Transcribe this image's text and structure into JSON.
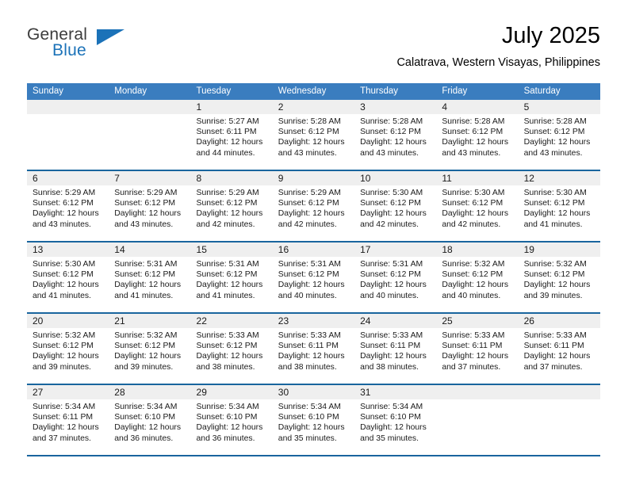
{
  "brand": {
    "name_line1": "General",
    "name_line2": "Blue",
    "flag_icon": "triangle-flag-icon"
  },
  "header": {
    "title": "July 2025",
    "subtitle": "Calatrava, Western Visayas, Philippines"
  },
  "colors": {
    "header_band": "#3a7dbf",
    "row_divider": "#19659e",
    "daynum_band": "#efefef",
    "brand_blue": "#1b72b8",
    "text": "#1a1a1a"
  },
  "weekday_headers": [
    "Sunday",
    "Monday",
    "Tuesday",
    "Wednesday",
    "Thursday",
    "Friday",
    "Saturday"
  ],
  "labels": {
    "sunrise_prefix": "Sunrise:",
    "sunset_prefix": "Sunset:",
    "daylight_prefix": "Daylight:"
  },
  "weeks": [
    [
      {
        "day": "",
        "empty": true
      },
      {
        "day": "",
        "empty": true
      },
      {
        "day": "1",
        "sunrise": "Sunrise: 5:27 AM",
        "sunset": "Sunset: 6:11 PM",
        "daylight1": "Daylight: 12 hours",
        "daylight2": "and 44 minutes."
      },
      {
        "day": "2",
        "sunrise": "Sunrise: 5:28 AM",
        "sunset": "Sunset: 6:12 PM",
        "daylight1": "Daylight: 12 hours",
        "daylight2": "and 43 minutes."
      },
      {
        "day": "3",
        "sunrise": "Sunrise: 5:28 AM",
        "sunset": "Sunset: 6:12 PM",
        "daylight1": "Daylight: 12 hours",
        "daylight2": "and 43 minutes."
      },
      {
        "day": "4",
        "sunrise": "Sunrise: 5:28 AM",
        "sunset": "Sunset: 6:12 PM",
        "daylight1": "Daylight: 12 hours",
        "daylight2": "and 43 minutes."
      },
      {
        "day": "5",
        "sunrise": "Sunrise: 5:28 AM",
        "sunset": "Sunset: 6:12 PM",
        "daylight1": "Daylight: 12 hours",
        "daylight2": "and 43 minutes."
      }
    ],
    [
      {
        "day": "6",
        "sunrise": "Sunrise: 5:29 AM",
        "sunset": "Sunset: 6:12 PM",
        "daylight1": "Daylight: 12 hours",
        "daylight2": "and 43 minutes."
      },
      {
        "day": "7",
        "sunrise": "Sunrise: 5:29 AM",
        "sunset": "Sunset: 6:12 PM",
        "daylight1": "Daylight: 12 hours",
        "daylight2": "and 43 minutes."
      },
      {
        "day": "8",
        "sunrise": "Sunrise: 5:29 AM",
        "sunset": "Sunset: 6:12 PM",
        "daylight1": "Daylight: 12 hours",
        "daylight2": "and 42 minutes."
      },
      {
        "day": "9",
        "sunrise": "Sunrise: 5:29 AM",
        "sunset": "Sunset: 6:12 PM",
        "daylight1": "Daylight: 12 hours",
        "daylight2": "and 42 minutes."
      },
      {
        "day": "10",
        "sunrise": "Sunrise: 5:30 AM",
        "sunset": "Sunset: 6:12 PM",
        "daylight1": "Daylight: 12 hours",
        "daylight2": "and 42 minutes."
      },
      {
        "day": "11",
        "sunrise": "Sunrise: 5:30 AM",
        "sunset": "Sunset: 6:12 PM",
        "daylight1": "Daylight: 12 hours",
        "daylight2": "and 42 minutes."
      },
      {
        "day": "12",
        "sunrise": "Sunrise: 5:30 AM",
        "sunset": "Sunset: 6:12 PM",
        "daylight1": "Daylight: 12 hours",
        "daylight2": "and 41 minutes."
      }
    ],
    [
      {
        "day": "13",
        "sunrise": "Sunrise: 5:30 AM",
        "sunset": "Sunset: 6:12 PM",
        "daylight1": "Daylight: 12 hours",
        "daylight2": "and 41 minutes."
      },
      {
        "day": "14",
        "sunrise": "Sunrise: 5:31 AM",
        "sunset": "Sunset: 6:12 PM",
        "daylight1": "Daylight: 12 hours",
        "daylight2": "and 41 minutes."
      },
      {
        "day": "15",
        "sunrise": "Sunrise: 5:31 AM",
        "sunset": "Sunset: 6:12 PM",
        "daylight1": "Daylight: 12 hours",
        "daylight2": "and 41 minutes."
      },
      {
        "day": "16",
        "sunrise": "Sunrise: 5:31 AM",
        "sunset": "Sunset: 6:12 PM",
        "daylight1": "Daylight: 12 hours",
        "daylight2": "and 40 minutes."
      },
      {
        "day": "17",
        "sunrise": "Sunrise: 5:31 AM",
        "sunset": "Sunset: 6:12 PM",
        "daylight1": "Daylight: 12 hours",
        "daylight2": "and 40 minutes."
      },
      {
        "day": "18",
        "sunrise": "Sunrise: 5:32 AM",
        "sunset": "Sunset: 6:12 PM",
        "daylight1": "Daylight: 12 hours",
        "daylight2": "and 40 minutes."
      },
      {
        "day": "19",
        "sunrise": "Sunrise: 5:32 AM",
        "sunset": "Sunset: 6:12 PM",
        "daylight1": "Daylight: 12 hours",
        "daylight2": "and 39 minutes."
      }
    ],
    [
      {
        "day": "20",
        "sunrise": "Sunrise: 5:32 AM",
        "sunset": "Sunset: 6:12 PM",
        "daylight1": "Daylight: 12 hours",
        "daylight2": "and 39 minutes."
      },
      {
        "day": "21",
        "sunrise": "Sunrise: 5:32 AM",
        "sunset": "Sunset: 6:12 PM",
        "daylight1": "Daylight: 12 hours",
        "daylight2": "and 39 minutes."
      },
      {
        "day": "22",
        "sunrise": "Sunrise: 5:33 AM",
        "sunset": "Sunset: 6:12 PM",
        "daylight1": "Daylight: 12 hours",
        "daylight2": "and 38 minutes."
      },
      {
        "day": "23",
        "sunrise": "Sunrise: 5:33 AM",
        "sunset": "Sunset: 6:11 PM",
        "daylight1": "Daylight: 12 hours",
        "daylight2": "and 38 minutes."
      },
      {
        "day": "24",
        "sunrise": "Sunrise: 5:33 AM",
        "sunset": "Sunset: 6:11 PM",
        "daylight1": "Daylight: 12 hours",
        "daylight2": "and 38 minutes."
      },
      {
        "day": "25",
        "sunrise": "Sunrise: 5:33 AM",
        "sunset": "Sunset: 6:11 PM",
        "daylight1": "Daylight: 12 hours",
        "daylight2": "and 37 minutes."
      },
      {
        "day": "26",
        "sunrise": "Sunrise: 5:33 AM",
        "sunset": "Sunset: 6:11 PM",
        "daylight1": "Daylight: 12 hours",
        "daylight2": "and 37 minutes."
      }
    ],
    [
      {
        "day": "27",
        "sunrise": "Sunrise: 5:34 AM",
        "sunset": "Sunset: 6:11 PM",
        "daylight1": "Daylight: 12 hours",
        "daylight2": "and 37 minutes."
      },
      {
        "day": "28",
        "sunrise": "Sunrise: 5:34 AM",
        "sunset": "Sunset: 6:10 PM",
        "daylight1": "Daylight: 12 hours",
        "daylight2": "and 36 minutes."
      },
      {
        "day": "29",
        "sunrise": "Sunrise: 5:34 AM",
        "sunset": "Sunset: 6:10 PM",
        "daylight1": "Daylight: 12 hours",
        "daylight2": "and 36 minutes."
      },
      {
        "day": "30",
        "sunrise": "Sunrise: 5:34 AM",
        "sunset": "Sunset: 6:10 PM",
        "daylight1": "Daylight: 12 hours",
        "daylight2": "and 35 minutes."
      },
      {
        "day": "31",
        "sunrise": "Sunrise: 5:34 AM",
        "sunset": "Sunset: 6:10 PM",
        "daylight1": "Daylight: 12 hours",
        "daylight2": "and 35 minutes."
      },
      {
        "day": "",
        "empty": true
      },
      {
        "day": "",
        "empty": true
      }
    ]
  ]
}
